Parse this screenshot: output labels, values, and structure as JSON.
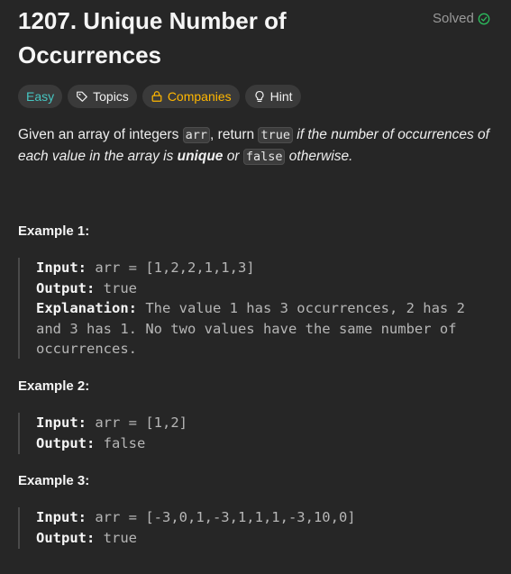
{
  "problem": {
    "title": "1207. Unique Number of Occurrences",
    "status": "Solved"
  },
  "tags": [
    {
      "label": "Easy",
      "icon": ""
    },
    {
      "label": "Topics",
      "icon": "tag-icon"
    },
    {
      "label": "Companies",
      "icon": "lock-icon"
    },
    {
      "label": "Hint",
      "icon": "lightbulb-icon"
    }
  ],
  "description": {
    "p1": "Given an array of integers ",
    "code_arr": "arr",
    "p2": ", return ",
    "code_true": "true",
    "p3": " if the number of occurrences of each value in the array is ",
    "bold_unique": "unique",
    "p4": " or ",
    "code_false": "false",
    "p5": " otherwise."
  },
  "examples": [
    {
      "title": "Example 1:",
      "input_label": "Input:",
      "input_value": " arr = [1,2,2,1,1,3]",
      "output_label": "Output:",
      "output_value": " true",
      "explanation_label": "Explanation:",
      "explanation_value": " The value 1 has 3 occurrences, 2 has 2 and 3 has 1. No two values have the same number of occurrences."
    },
    {
      "title": "Example 2:",
      "input_label": "Input:",
      "input_value": " arr = [1,2]",
      "output_label": "Output:",
      "output_value": " false"
    },
    {
      "title": "Example 3:",
      "input_label": "Input:",
      "input_value": " arr = [-3,0,1,-3,1,1,1,-3,10,0]",
      "output_label": "Output:",
      "output_value": " true"
    }
  ],
  "colors": {
    "background": "#262626",
    "easy": "#46c6c2",
    "companies": "#ffb700",
    "solved_check": "#2cbb5d"
  }
}
